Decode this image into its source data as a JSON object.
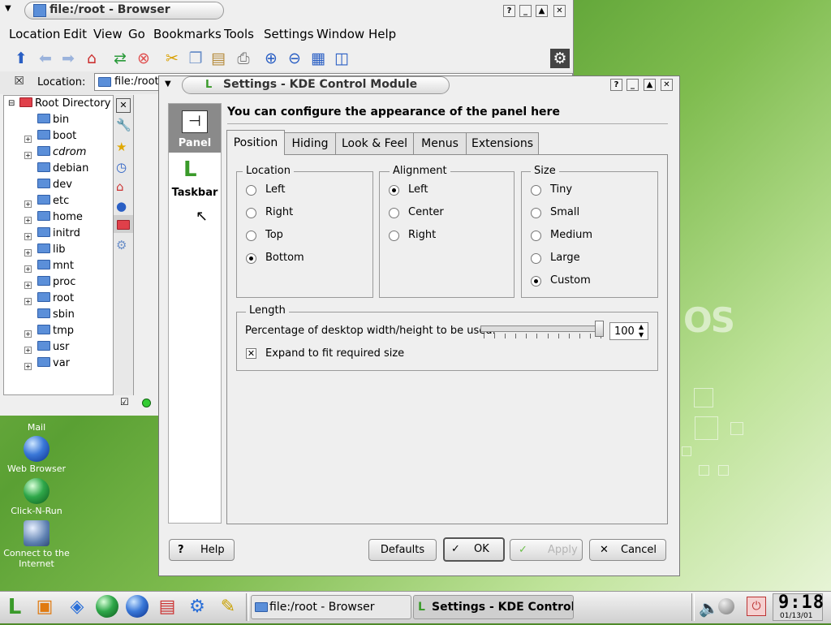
{
  "desktop": {
    "brand_text": "OS",
    "icons": [
      {
        "label": "Mail"
      },
      {
        "label": "Web Browser"
      },
      {
        "label": "Click-N-Run"
      },
      {
        "label": "Connect to the Internet"
      }
    ]
  },
  "browser": {
    "title": "file:/root - Browser",
    "menu": [
      "Location",
      "Edit",
      "View",
      "Go",
      "Bookmarks",
      "Tools",
      "Settings",
      "Window",
      "Help"
    ],
    "location_label": "Location:",
    "location_value": "file:/root",
    "tree_root": "Root Directory",
    "tree": [
      "bin",
      "boot",
      "cdrom",
      "debian",
      "dev",
      "etc",
      "home",
      "initrd",
      "lib",
      "mnt",
      "proc",
      "root",
      "sbin",
      "tmp",
      "usr",
      "var"
    ]
  },
  "dialog": {
    "title": "Settings - KDE Control Module",
    "sidebar": [
      {
        "label": "Panel"
      },
      {
        "label": "Taskbar"
      }
    ],
    "heading": "You can configure the appearance of the panel here",
    "tabs": [
      "Position",
      "Hiding",
      "Look & Feel",
      "Menus",
      "Extensions"
    ],
    "location": {
      "title": "Location",
      "options": [
        "Left",
        "Right",
        "Top",
        "Bottom"
      ],
      "selected": "Bottom"
    },
    "alignment": {
      "title": "Alignment",
      "options": [
        "Left",
        "Center",
        "Right"
      ],
      "selected": "Left"
    },
    "size": {
      "title": "Size",
      "options": [
        "Tiny",
        "Small",
        "Medium",
        "Large",
        "Custom"
      ],
      "selected": "Custom"
    },
    "length": {
      "title": "Length",
      "slider_label": "Percentage of desktop width/height to be used:",
      "value": "100",
      "slider_fraction": 1.0,
      "expand_label": "Expand to fit required size",
      "expand_checked": true
    },
    "buttons": {
      "help": "Help",
      "defaults": "Defaults",
      "ok": "OK",
      "apply": "Apply",
      "cancel": "Cancel"
    }
  },
  "taskbar": {
    "tasks": [
      {
        "label": "file:/root - Browser",
        "active": false
      },
      {
        "label": "Settings - KDE Control Module",
        "active": true
      }
    ],
    "clock_time": "9:18",
    "clock_date": "01/13/01"
  }
}
